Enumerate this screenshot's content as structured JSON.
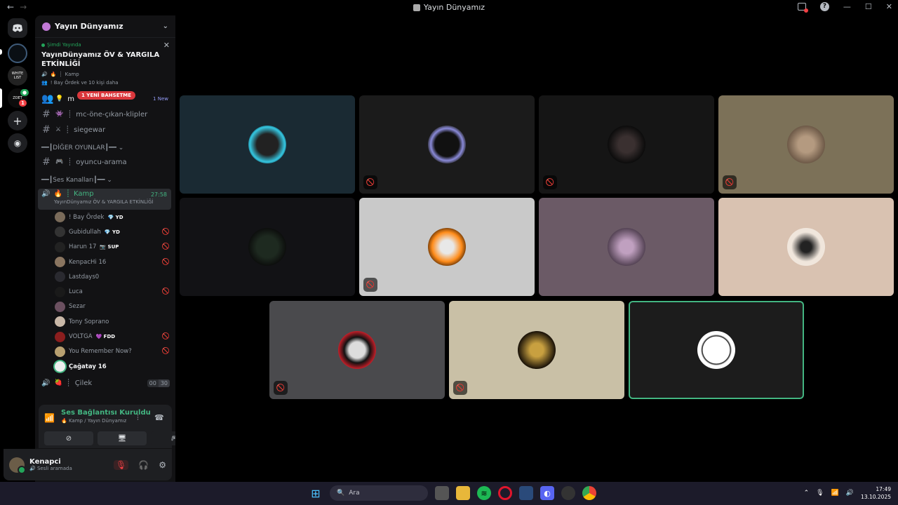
{
  "window": {
    "title": "Yayın Dünyamız"
  },
  "rail": {
    "server2_label": "WHITE LIST",
    "server3_label": "ZOET",
    "server3_badge": "1"
  },
  "sidebar": {
    "guild_name": "Yayın Dünyamız",
    "event": {
      "live_label": "Şimdi Yayında",
      "title": "YayınDünyamız ÖV & YARGILA ETKİNLİĞİ",
      "channel": "Kamp",
      "attendees": "! Bay Ördek ve 10 kişi daha"
    },
    "channels_top": [
      {
        "name": "m",
        "mention": "1 YENİ BAHSETME",
        "new": "1 New"
      },
      {
        "name": "mc-öne-çıkan-klipler"
      },
      {
        "name": "siegewar"
      }
    ],
    "cat_games": "DİĞER OYUNLAR",
    "channel_games": "oyuncu-arama",
    "cat_voice": "Ses Kanalları",
    "voice_channel": {
      "name": "Kamp",
      "time": "27:58",
      "event": "YayınDünyamız ÖV & YARGILA ETKİNLİĞİ"
    },
    "voice_users": [
      {
        "name": "! Bay Ördek",
        "tag": "YD",
        "muted": false
      },
      {
        "name": "Gubidullah",
        "tag": "YD",
        "muted": true
      },
      {
        "name": "Harun 17",
        "tag": "SUP",
        "muted": true
      },
      {
        "name": "KenpacHi 16",
        "tag": "",
        "muted": true
      },
      {
        "name": "Lastdays0",
        "tag": "",
        "muted": false
      },
      {
        "name": "Luca",
        "tag": "",
        "muted": true
      },
      {
        "name": "Sezar",
        "tag": "",
        "muted": false
      },
      {
        "name": "Tony Soprano",
        "tag": "",
        "muted": false
      },
      {
        "name": "VOLTGA",
        "tag": "FDD",
        "muted": true
      },
      {
        "name": "You Remember Now?",
        "tag": "",
        "muted": true
      },
      {
        "name": "Çağatay 16",
        "tag": "",
        "muted": false
      }
    ],
    "voice_channel2": {
      "name": "Çilek",
      "count": "00",
      "limit": "30"
    }
  },
  "voice_panel": {
    "status": "Ses Bağlantısı Kuruldu",
    "location": "Kamp / Yayın Dünyamız"
  },
  "user_panel": {
    "name": "Kenapci",
    "status": "Sesli aramada"
  },
  "taskbar": {
    "search_placeholder": "Ara",
    "time": "17:49",
    "date": "13.10.2025"
  },
  "colors": {
    "accent_green": "#43b581",
    "mention_red": "#da373c"
  }
}
